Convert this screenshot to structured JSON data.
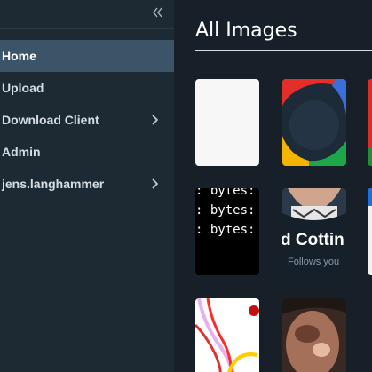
{
  "sidebar": {
    "collapse_icon": "double-chevron-left-icon",
    "items": [
      {
        "label": "Home",
        "active": true,
        "has_submenu": false
      },
      {
        "label": "Upload",
        "active": false,
        "has_submenu": false
      },
      {
        "label": "Download Client",
        "active": false,
        "has_submenu": true
      },
      {
        "label": "Admin",
        "active": false,
        "has_submenu": false
      },
      {
        "label": "jens.langhammer",
        "active": false,
        "has_submenu": true
      }
    ]
  },
  "main": {
    "title": "All Images",
    "tiles": [
      {
        "name": "image-tile-blank",
        "lines": []
      },
      {
        "name": "image-tile-color-circle",
        "lines": []
      },
      {
        "name": "image-tile-red-edge",
        "lines": []
      },
      {
        "name": "image-tile-terminal",
        "lines": [
          ": bytes:",
          ": bytes:"
        ]
      },
      {
        "name": "image-tile-social-card",
        "lines": [
          "d Cottin",
          "Follows you"
        ]
      },
      {
        "name": "image-tile-white-edge",
        "lines": []
      },
      {
        "name": "image-tile-line-drawing",
        "lines": []
      },
      {
        "name": "image-tile-photo",
        "lines": []
      }
    ]
  },
  "colors": {
    "sidebar_bg": "#1e2a33",
    "main_bg": "#172029",
    "active_bg": "#3b5468"
  }
}
